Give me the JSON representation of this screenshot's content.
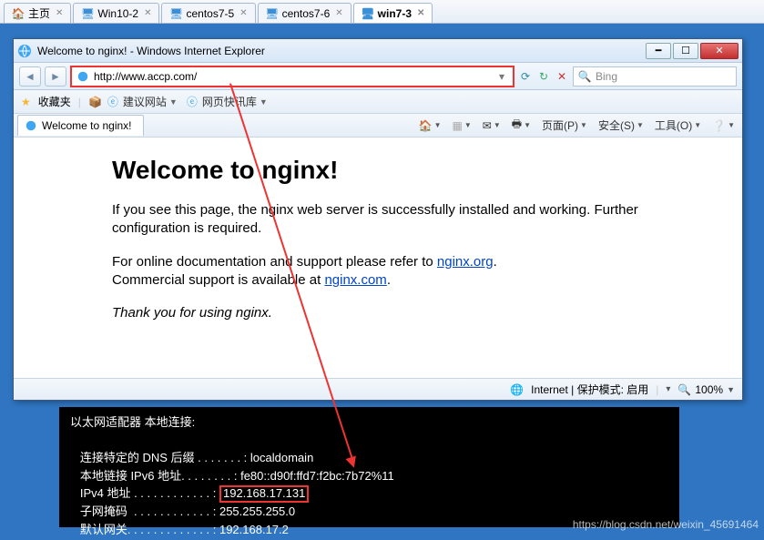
{
  "tabs": [
    {
      "label": "主页",
      "icon": "home"
    },
    {
      "label": "Win10-2",
      "icon": "host"
    },
    {
      "label": "centos7-5",
      "icon": "host"
    },
    {
      "label": "centos7-6",
      "icon": "host"
    },
    {
      "label": "win7-3",
      "icon": "host",
      "active": true
    }
  ],
  "ie": {
    "title": "Welcome to nginx! - Windows Internet Explorer",
    "url": "http://www.accp.com/",
    "search_placeholder": "Bing",
    "favorites_label": "收藏夹",
    "fav_items": [
      "建议网站",
      "网页快讯库"
    ],
    "page_tab": "Welcome to nginx!",
    "menu": {
      "home": "",
      "feed": "",
      "mail": "",
      "print": "",
      "page": "页面(P)",
      "safety": "安全(S)",
      "tools": "工具(O)",
      "help": ""
    },
    "status": {
      "zone": "Internet | 保护模式: 启用",
      "zoom": "100%"
    }
  },
  "nginx": {
    "heading": "Welcome to nginx!",
    "p1": "If you see this page, the nginx web server is successfully installed and working. Further configuration is required.",
    "p2a": "For online documentation and support please refer to ",
    "link1_text": "nginx.org",
    "p2b": ".",
    "p3a": "Commercial support is available at ",
    "link2_text": "nginx.com",
    "p3b": ".",
    "thanks": "Thank you for using nginx."
  },
  "terminal": {
    "header": "以太网适配器 本地连接:",
    "lines": {
      "dns_suffix_label": "   连接特定的 DNS 后缀 . . . . . . . : ",
      "dns_suffix_value": "localdomain",
      "ipv6_label": "   本地链接 IPv6 地址. . . . . . . . : ",
      "ipv6_value": "fe80::d90f:ffd7:f2bc:7b72%11",
      "ipv4_label": "   IPv4 地址 . . . . . . . . . . . . : ",
      "ipv4_value": "192.168.17.131",
      "mask_label": "   子网掩码  . . . . . . . . . . . . : ",
      "mask_value": "255.255.255.0",
      "gw_label": "   默认网关. . . . . . . . . . . . . : ",
      "gw_value": "192.168.17.2"
    }
  },
  "watermark": "https://blog.csdn.net/weixin_45691464"
}
